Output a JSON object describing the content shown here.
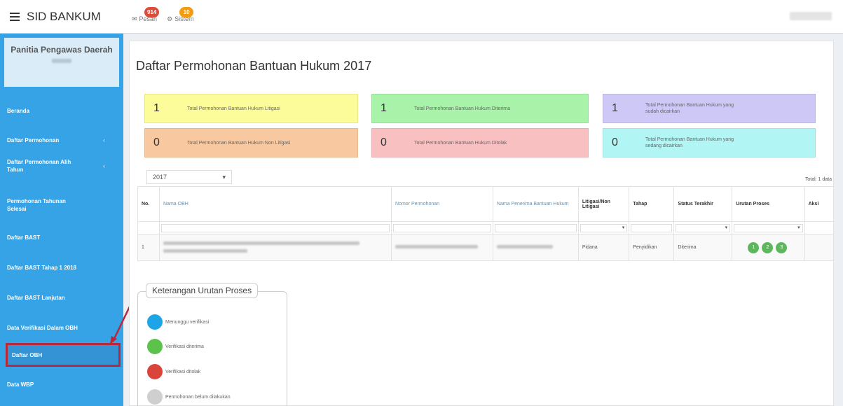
{
  "brand": {
    "title": "SID BANKUM"
  },
  "topnav": {
    "pesan_label": "Pesan",
    "pesan_count": "914",
    "sistem_label": "Sistem",
    "sistem_count": "10"
  },
  "sidebar": {
    "panel_title": "Panitia Pengawas Daerah",
    "items": [
      {
        "label": "Beranda"
      },
      {
        "label": "Daftar Permohonan",
        "chevron": "‹"
      },
      {
        "label": "Daftar Permohonan Alih Tahun",
        "chevron": "‹"
      },
      {
        "label": "Permohonan Tahunan Selesai"
      },
      {
        "label": "Daftar BAST"
      },
      {
        "label": "Daftar BAST Tahap 1 2018"
      },
      {
        "label": "Daftar BAST Lanjutan"
      },
      {
        "label": "Data Verifikasi Dalam OBH"
      },
      {
        "label": "Daftar OBH"
      },
      {
        "label": "Data WBP"
      }
    ]
  },
  "page": {
    "title": "Daftar Permohonan Bantuan Hukum 2017"
  },
  "stats": [
    {
      "value": "1",
      "label": "Total Permohonan Bantuan Hukum Litigasi",
      "color": "#fcfc9a"
    },
    {
      "value": "1",
      "label": "Total Permohonan Bantuan Hukum Diterima",
      "color": "#a9f2a9"
    },
    {
      "value": "1",
      "label": "Total Permohonan Bantuan Hukum yang sudah dicairkan",
      "color": "#cdc8f5"
    },
    {
      "value": "0",
      "label": "Total Permohonan Bantuan Hukum Non Litigasi",
      "color": "#f8c8a0"
    },
    {
      "value": "0",
      "label": "Total Permohonan Bantuan Hukum Ditolak",
      "color": "#f9c0c2"
    },
    {
      "value": "0",
      "label": "Total Permohonan Bantuan Hukum yang sedang dicairkan",
      "color": "#b2f5f5"
    }
  ],
  "filter": {
    "year": "2017",
    "total": "Total: 1 data"
  },
  "table": {
    "headers": [
      "No.",
      "Nama OBH",
      "Nomor Permohonan",
      "Nama Penerima Bantuan Hukum",
      "Litigasi/Non Litigasi",
      "Tahap",
      "Status Terakhir",
      "Urutan Proses",
      "Aksi"
    ],
    "rows": [
      {
        "no": "1",
        "litigasi": "Pidana",
        "tahap": "Penyidikan",
        "status": "Diterima",
        "steps": [
          "1",
          "2",
          "3"
        ]
      }
    ]
  },
  "legend": {
    "title": "Keterangan Urutan Proses",
    "items": [
      {
        "label": "Menunggu verifikasi",
        "color": "#1ea5e8"
      },
      {
        "label": "Verifikasi diterima",
        "color": "#5cc24b"
      },
      {
        "label": "Verifikasi ditolak",
        "color": "#d9443b"
      },
      {
        "label": "Permohonan belum dilakukan",
        "color": "#cfcfcf"
      }
    ]
  },
  "colors": {
    "sidebar": "#35a3e6",
    "highlight": "#b8283a",
    "step": "#5cb85c"
  }
}
